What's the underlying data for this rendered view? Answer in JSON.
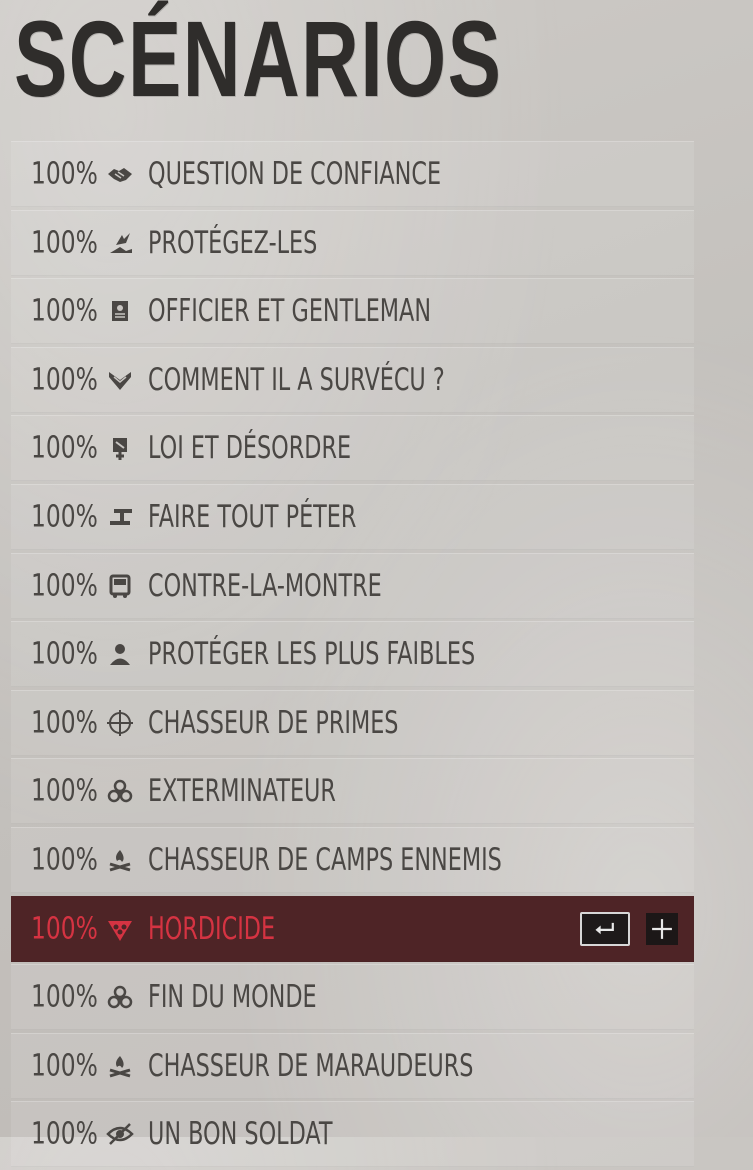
{
  "page": {
    "title": "SCÉNARIOS"
  },
  "colors": {
    "active_row_bg": "#4e2426",
    "active_text": "#d53342",
    "text": "#4a4744"
  },
  "scenarios": [
    {
      "percent": "100%",
      "label": "QUESTION DE CONFIANCE",
      "icon": "handshake-icon"
    },
    {
      "percent": "100%",
      "label": "PROTÉGEZ-LES",
      "icon": "hand-bird-icon"
    },
    {
      "percent": "100%",
      "label": "OFFICIER ET GENTLEMAN",
      "icon": "badge-icon"
    },
    {
      "percent": "100%",
      "label": "COMMENT IL A SURVÉCU ?",
      "icon": "chevron-rank-icon"
    },
    {
      "percent": "100%",
      "label": "LOI ET DÉSORDRE",
      "icon": "outlaw-icon"
    },
    {
      "percent": "100%",
      "label": "FAIRE TOUT PÉTER",
      "icon": "detonator-icon"
    },
    {
      "percent": "100%",
      "label": "CONTRE-LA-MONTRE",
      "icon": "truck-icon"
    },
    {
      "percent": "100%",
      "label": "PROTÉGER LES PLUS FAIBLES",
      "icon": "person-icon"
    },
    {
      "percent": "100%",
      "label": "CHASSEUR DE PRIMES",
      "icon": "crosshair-icon"
    },
    {
      "percent": "100%",
      "label": "EXTERMINATEUR",
      "icon": "biohazard-icon"
    },
    {
      "percent": "100%",
      "label": "CHASSEUR DE CAMPS ENNEMIS",
      "icon": "campfire-icon"
    },
    {
      "percent": "100%",
      "label": "HORDICIDE",
      "icon": "horde-icon",
      "active": true
    },
    {
      "percent": "100%",
      "label": "FIN DU MONDE",
      "icon": "biohazard-icon"
    },
    {
      "percent": "100%",
      "label": "CHASSEUR DE MARAUDEURS",
      "icon": "campfire-icon"
    },
    {
      "percent": "100%",
      "label": "UN BON SOLDAT",
      "icon": "eye-slash-icon"
    }
  ],
  "active_controls": {
    "select_key": "enter-key-icon",
    "expand": "plus-icon"
  }
}
